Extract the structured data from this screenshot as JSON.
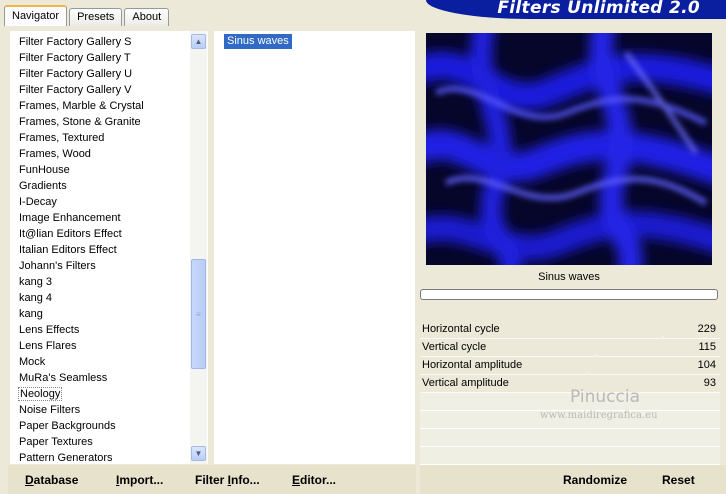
{
  "tabs": [
    {
      "label": "Navigator",
      "active": true
    },
    {
      "label": "Presets",
      "active": false
    },
    {
      "label": "About",
      "active": false
    }
  ],
  "header": {
    "title": "Filters Unlimited 2.0"
  },
  "categories": {
    "items": [
      "Filter Factory Gallery S",
      "Filter Factory Gallery T",
      "Filter Factory Gallery U",
      "Filter Factory Gallery V",
      "Frames, Marble & Crystal",
      "Frames, Stone & Granite",
      "Frames, Textured",
      "Frames, Wood",
      "FunHouse",
      "Gradients",
      "I-Decay",
      "Image Enhancement",
      "It@lian Editors Effect",
      "Italian Editors Effect",
      "Johann's Filters",
      "kang 3",
      "kang 4",
      "kang",
      "Lens Effects",
      "Lens Flares",
      "Mock",
      "MuRa's Seamless",
      "Neology",
      "Noise Filters",
      "Paper Backgrounds",
      "Paper Textures",
      "Pattern Generators"
    ],
    "selected": "Neology"
  },
  "filters": {
    "items": [
      "Sinus waves"
    ],
    "selected": "Sinus waves"
  },
  "preview": {
    "filter_name": "Sinus waves",
    "progress": 0,
    "accent_color": "#1e1ef0"
  },
  "params": [
    {
      "label": "Horizontal cycle",
      "value": "229",
      "level": 0.898
    },
    {
      "label": "Vertical cycle",
      "value": "115",
      "level": 0.451
    },
    {
      "label": "Horizontal amplitude",
      "value": "104",
      "level": 0.408
    },
    {
      "label": "Vertical amplitude",
      "value": "93",
      "level": 0.365
    }
  ],
  "watermark": {
    "line1": "Pinuccia",
    "line2": "www.maidiregrafica.eu"
  },
  "buttons": {
    "database": {
      "first": "D",
      "rest": "atabase"
    },
    "import": {
      "first": "I",
      "rest": "mport..."
    },
    "filter_info": {
      "first": "Filter ",
      "u": "I",
      "rest": "nfo..."
    },
    "editor": {
      "first": "E",
      "rest": "ditor..."
    },
    "randomize": "Randomize",
    "reset": "Reset"
  }
}
